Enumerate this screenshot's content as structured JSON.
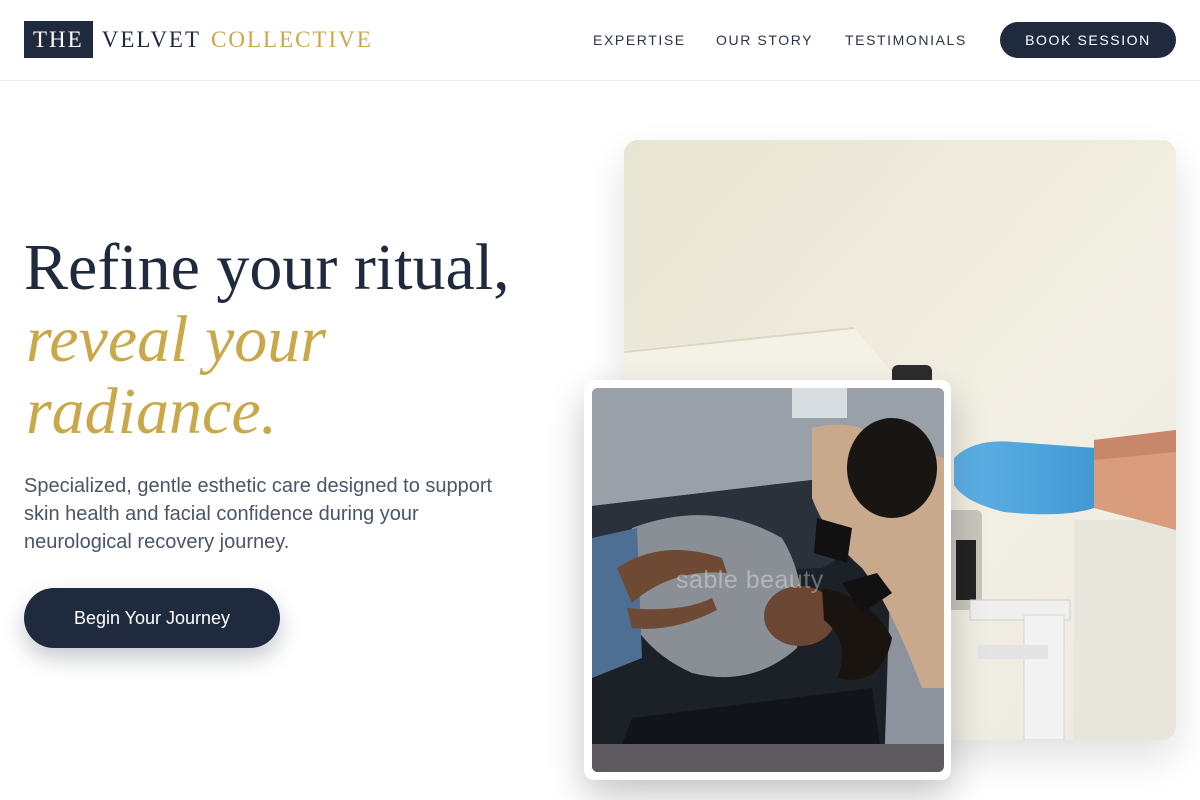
{
  "logo": {
    "boxed_word": "THE",
    "word_middle": "VELVET",
    "word_gold": "COLLECTIVE"
  },
  "nav": {
    "items": [
      {
        "label": "EXPERTISE"
      },
      {
        "label": "OUR STORY"
      },
      {
        "label": "TESTIMONIALS"
      }
    ],
    "book_label": "BOOK SESSION"
  },
  "hero": {
    "headline_line1": "Refine your ritual,",
    "headline_line2": "reveal your",
    "headline_line3": "radiance.",
    "description": "Specialized, gentle esthetic care designed to support skin health and facial confidence during your neurological recovery journey.",
    "cta_label": "Begin Your Journey"
  },
  "images": {
    "watermark_text": "sable beauty"
  },
  "colors": {
    "navy": "#1f2a3f",
    "gold": "#c9a84a",
    "body_text": "#4a5568",
    "background": "#ffffff"
  }
}
